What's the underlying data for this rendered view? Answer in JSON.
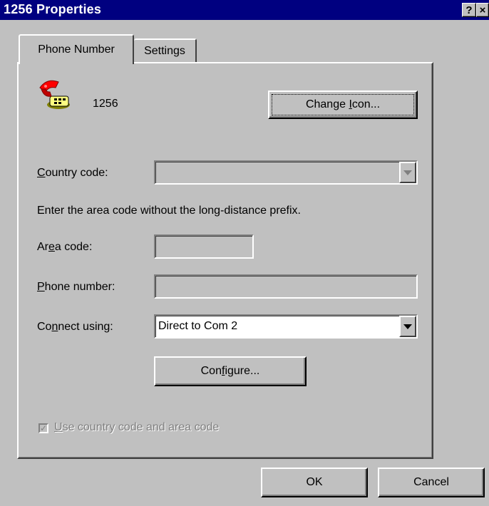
{
  "window": {
    "title": "1256 Properties",
    "help_button": "?",
    "close_button": "×"
  },
  "tabs": [
    {
      "label": "Phone Number",
      "selected": true
    },
    {
      "label": "Settings",
      "selected": false
    }
  ],
  "connection": {
    "name": "1256",
    "icon": "telephone-icon",
    "change_icon_label_pre": "Change ",
    "change_icon_label_key": "I",
    "change_icon_label_post": "con..."
  },
  "country_code": {
    "label_key": "C",
    "label_rest": "ountry code:",
    "value": "",
    "enabled": false
  },
  "instruction": "Enter the area code without the long-distance prefix.",
  "area_code": {
    "label_pre": "Ar",
    "label_key": "e",
    "label_post": "a code:",
    "value": ""
  },
  "phone_number": {
    "label_key": "P",
    "label_rest": "hone number:",
    "value": ""
  },
  "connect_using": {
    "label_pre": "Co",
    "label_key": "n",
    "label_post": "nect using:",
    "value": "Direct to Com 2"
  },
  "configure_button": {
    "pre": "Con",
    "key": "f",
    "post": "igure..."
  },
  "use_country_code": {
    "label_key": "U",
    "label_rest": "se country code and area code",
    "checked": true,
    "enabled": false
  },
  "footer": {
    "ok_label": "OK",
    "cancel_label": "Cancel"
  },
  "colors": {
    "title_bar": "#000080",
    "face": "#c0c0c0"
  }
}
